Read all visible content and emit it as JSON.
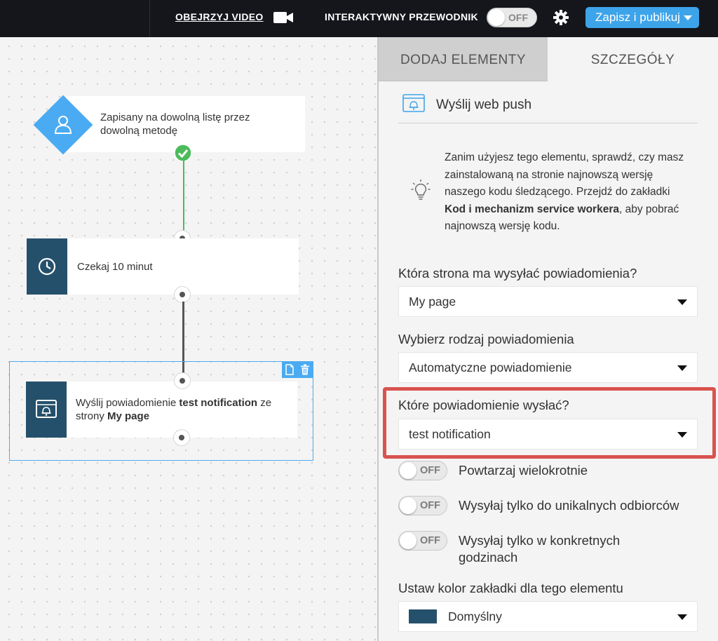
{
  "topbar": {
    "video_label": "OBEJRZYJ VIDEO",
    "guide_label": "INTERAKTYWNY PRZEWODNIK",
    "guide_toggle": "OFF",
    "publish_label": "Zapisz i publikuj"
  },
  "workflow": {
    "trigger_text": "Zapisany na dowolną listę przez dowolną metodę",
    "wait_text": "Czekaj 10 minut",
    "push": {
      "prefix": "Wyślij powiadomienie ",
      "notification": "test notification",
      "middle": " ze strony ",
      "page": "My page"
    }
  },
  "panel": {
    "tabs": [
      "DODAJ ELEMENTY",
      "SZCZEGÓŁY"
    ],
    "section_title": "Wyślij web push",
    "info": {
      "before": "Zanim użyjesz tego elementu, sprawdź, czy masz zainstalowaną na stronie najnowszą wersję naszego kodu śledzącego. Przejdź do zakładki ",
      "bold": "Kod i mechanizm service workera",
      "after": ", aby pobrać najnowszą wersję kodu."
    },
    "fields": [
      {
        "label": "Która strona ma wysyłać powiadomienia?",
        "value": "My page"
      },
      {
        "label": "Wybierz rodzaj powiadomienia",
        "value": "Automatyczne powiadomienie"
      },
      {
        "label": "Które powiadomienie wysłać?",
        "value": "test notification"
      }
    ],
    "toggles": [
      {
        "state": "OFF",
        "label": "Powtarzaj wielokrotnie"
      },
      {
        "state": "OFF",
        "label": "Wysyłaj tylko do unikalnych odbiorców"
      },
      {
        "state": "OFF",
        "label": "Wysyłaj tylko w konkretnych godzinach"
      }
    ],
    "color_field": {
      "label": "Ustaw kolor zakładki dla tego elementu",
      "value": "Domyślny",
      "swatch": "#25506b"
    }
  },
  "colors": {
    "accent": "#3ea4ea",
    "node_dark": "#25506b",
    "success": "#4cbb5a",
    "highlight": "#d9534f"
  }
}
